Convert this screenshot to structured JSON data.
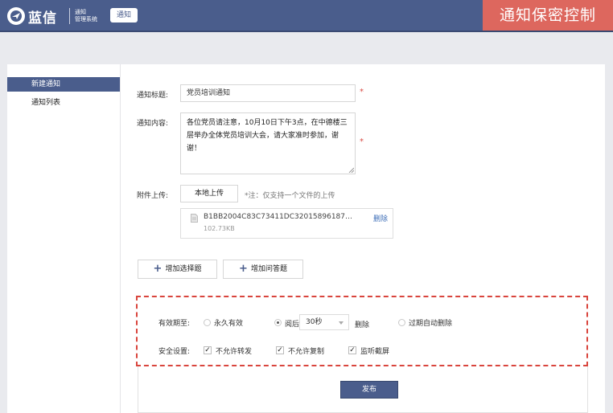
{
  "header": {
    "app_name": "蓝信",
    "system_line1": "通知",
    "system_line2": "管理系统",
    "module_tab": "通知",
    "banner": "通知保密控制"
  },
  "sidebar": {
    "items": [
      {
        "label": "新建通知",
        "active": true
      },
      {
        "label": "通知列表",
        "active": false
      }
    ]
  },
  "form": {
    "title_label": "通知标题:",
    "title_value": "党员培训通知",
    "content_label": "通知内容:",
    "content_value": "各位党员请注意，10月10日下午3点，在中德楼三层举办全体党员培训大会，请大家准时参加，谢谢！",
    "required_mark": "*",
    "attachment_label": "附件上传:",
    "upload_button": "本地上传",
    "upload_hint": "*注：仅支持一个文件的上传",
    "file": {
      "name": "B1BB2004C83C73411DC32015896187…",
      "size": "102.73KB",
      "delete": "删除"
    },
    "add_choice_button": "增加选择题",
    "add_question_button": "增加问答题"
  },
  "settings": {
    "validity_label": "有效期至:",
    "option_permanent": "永久有效",
    "option_after_read": "阅后",
    "after_read_value": "30秒",
    "after_read_suffix": "删除",
    "option_expire_delete": "过期自动删除",
    "selected_option": "阅后",
    "security_label": "安全设置:",
    "checks": [
      {
        "label": "不允许转发",
        "checked": true
      },
      {
        "label": "不允许复制",
        "checked": true
      },
      {
        "label": "监听截屏",
        "checked": true
      }
    ]
  },
  "publish_button": "发布",
  "colors": {
    "header_bg": "#4a5d8c",
    "banner_bg": "#dd675e",
    "highlight_border": "#d9453d",
    "link": "#3f6fb8"
  }
}
